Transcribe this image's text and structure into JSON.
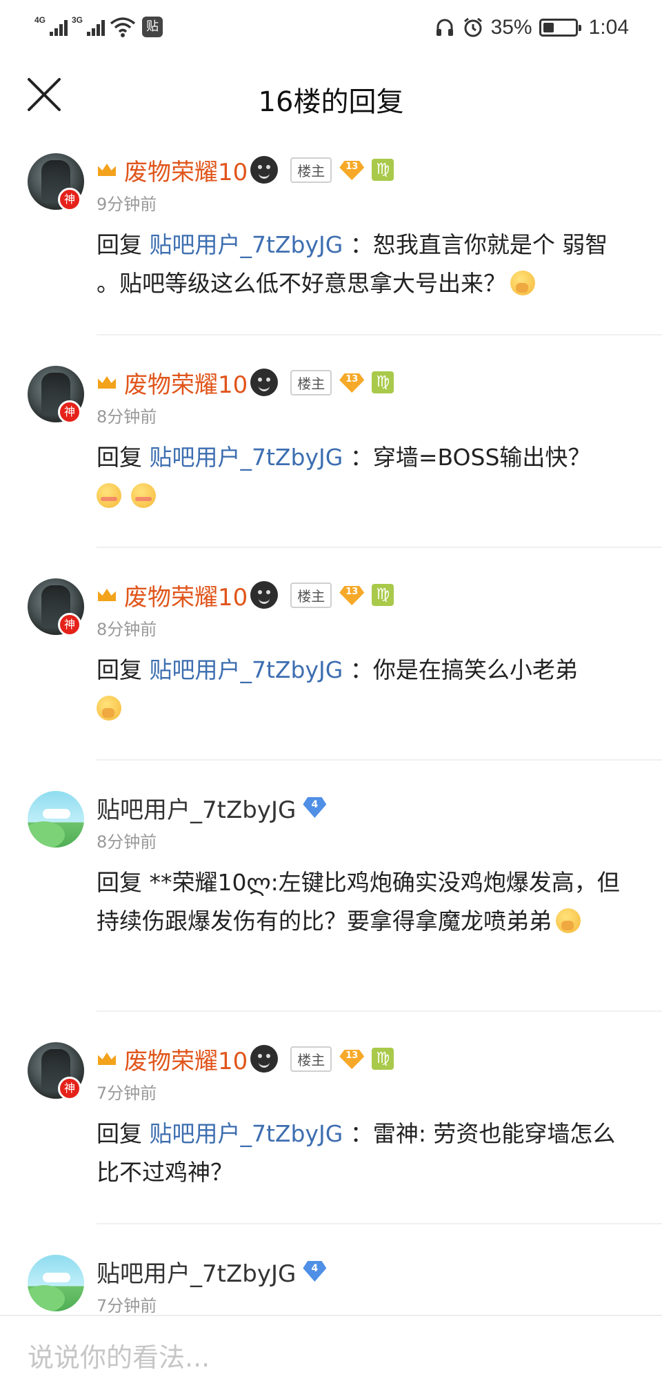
{
  "status_bar": {
    "signal_1_label": "4G",
    "signal_2_label": "3G",
    "tieba_icon": "贴",
    "battery_percent": "35%",
    "battery_level": 0.35,
    "time": "1:04"
  },
  "nav": {
    "title": "16楼的回复"
  },
  "posts": [
    {
      "author": "废物荣耀10",
      "owner_tag": "楼主",
      "level": "13",
      "zodiac": "♍",
      "time": "9分钟前",
      "prefix": "回复 ",
      "mention": "贴吧用户_7tZbyJG",
      "text": " ：恕我直言你就是个 弱智 。贴吧等级这么低不好意思拿大号出来？"
    },
    {
      "author": "废物荣耀10",
      "owner_tag": "楼主",
      "level": "13",
      "zodiac": "♍",
      "time": "8分钟前",
      "prefix": "回复 ",
      "mention": "贴吧用户_7tZbyJG",
      "text": " ：穿墙=BOSS输出快？"
    },
    {
      "author": "废物荣耀10",
      "owner_tag": "楼主",
      "level": "13",
      "zodiac": "♍",
      "time": "8分钟前",
      "prefix": "回复 ",
      "mention": "贴吧用户_7tZbyJG",
      "text": " ：你是在搞笑么小老弟"
    },
    {
      "author": "贴吧用户_7tZbyJG",
      "level": "4",
      "time": "8分钟前",
      "text": "回复 **荣耀10ლ:左键比鸡炮确实没鸡炮爆发高，但持续伤跟爆发伤有的比？要拿得拿魔龙喷弟弟"
    },
    {
      "author": "废物荣耀10",
      "owner_tag": "楼主",
      "level": "13",
      "zodiac": "♍",
      "time": "7分钟前",
      "prefix": "回复 ",
      "mention": "贴吧用户_7tZbyJG",
      "text": " ：雷神: 劳资也能穿墙怎么比不过鸡神？"
    },
    {
      "author": "贴吧用户_7tZbyJG",
      "level": "4",
      "time": "7分钟前"
    }
  ],
  "god_badge": "神",
  "reply_box": {
    "placeholder": "说说你的看法..."
  }
}
